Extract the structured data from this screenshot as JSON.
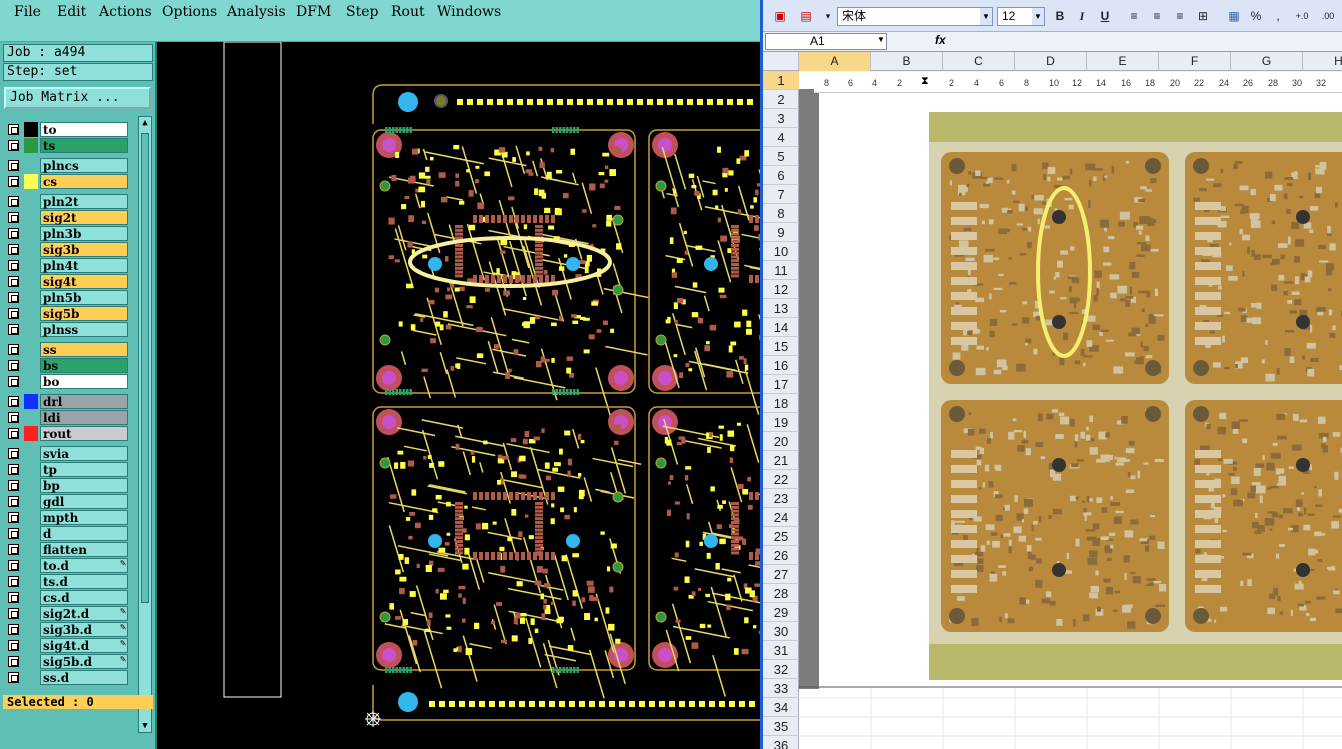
{
  "cam": {
    "menu": [
      "File",
      "Edit",
      "Actions",
      "Options",
      "Analysis",
      "DFM",
      "Step",
      "Rout",
      "Windows"
    ],
    "job_label": "Job : a494",
    "step_label": "Step: set",
    "job_matrix_button": "Job Matrix ...",
    "selected_status": "Selected : 0",
    "layers": [
      {
        "name": "to",
        "color": "#ffffff",
        "swatch": "#000000"
      },
      {
        "name": "ts",
        "color": "#2aa36a",
        "swatch": "#2a9a44"
      },
      {
        "name": "plncs",
        "color": "#8fe0d8",
        "swatch": ""
      },
      {
        "name": "cs",
        "color": "#ffce57",
        "swatch": "#ffff55"
      },
      {
        "name": "pln2t",
        "color": "#8fe0d8",
        "swatch": ""
      },
      {
        "name": "sig2t",
        "color": "#ffce57",
        "swatch": ""
      },
      {
        "name": "pln3b",
        "color": "#8fe0d8",
        "swatch": ""
      },
      {
        "name": "sig3b",
        "color": "#ffce57",
        "swatch": ""
      },
      {
        "name": "pln4t",
        "color": "#8fe0d8",
        "swatch": ""
      },
      {
        "name": "sig4t",
        "color": "#ffce57",
        "swatch": ""
      },
      {
        "name": "pln5b",
        "color": "#8fe0d8",
        "swatch": ""
      },
      {
        "name": "sig5b",
        "color": "#ffce57",
        "swatch": ""
      },
      {
        "name": "plnss",
        "color": "#8fe0d8",
        "swatch": ""
      },
      {
        "name": "ss",
        "color": "#ffce57",
        "swatch": ""
      },
      {
        "name": "bs",
        "color": "#2aa36a",
        "swatch": ""
      },
      {
        "name": "bo",
        "color": "#ffffff",
        "swatch": ""
      },
      {
        "name": "drl",
        "color": "#9aa3a8",
        "swatch": "#1030ff"
      },
      {
        "name": "ldi",
        "color": "#9aa3a8",
        "swatch": ""
      },
      {
        "name": "rout",
        "color": "#c9cdd0",
        "swatch": "#ff2020"
      },
      {
        "name": "svia",
        "color": "#8fe0d8",
        "swatch": ""
      },
      {
        "name": "tp",
        "color": "#8fe0d8",
        "swatch": ""
      },
      {
        "name": "bp",
        "color": "#8fe0d8",
        "swatch": ""
      },
      {
        "name": "gdl",
        "color": "#8fe0d8",
        "swatch": ""
      },
      {
        "name": "mpth",
        "color": "#8fe0d8",
        "swatch": ""
      },
      {
        "name": "d",
        "color": "#8fe0d8",
        "swatch": ""
      },
      {
        "name": "flatten",
        "color": "#8fe0d8",
        "swatch": ""
      },
      {
        "name": "to.d",
        "color": "#8fe0d8",
        "swatch": ""
      },
      {
        "name": "ts.d",
        "color": "#8fe0d8",
        "swatch": ""
      },
      {
        "name": "cs.d",
        "color": "#8fe0d8",
        "swatch": ""
      },
      {
        "name": "sig2t.d",
        "color": "#8fe0d8",
        "swatch": ""
      },
      {
        "name": "sig3b.d",
        "color": "#8fe0d8",
        "swatch": ""
      },
      {
        "name": "sig4t.d",
        "color": "#8fe0d8",
        "swatch": ""
      },
      {
        "name": "sig5b.d",
        "color": "#8fe0d8",
        "swatch": ""
      },
      {
        "name": "ss.d",
        "color": "#8fe0d8",
        "swatch": ""
      }
    ]
  },
  "excel": {
    "font_name": "宋体",
    "font_size": "12",
    "name_box": "A1",
    "fx": "fx",
    "columns": [
      "A",
      "B",
      "C",
      "D",
      "E",
      "F",
      "G",
      "H"
    ],
    "rows": [
      "1",
      "2",
      "3",
      "4",
      "5",
      "6",
      "7",
      "8",
      "9",
      "10",
      "11",
      "12",
      "13",
      "14",
      "15",
      "16",
      "17",
      "18",
      "19",
      "20",
      "21",
      "22",
      "23",
      "24",
      "25",
      "26",
      "27",
      "28",
      "29",
      "30",
      "31",
      "32",
      "33",
      "34",
      "35",
      "36"
    ],
    "ruler_ticks": [
      "8",
      "6",
      "4",
      "2",
      "2",
      "4",
      "6",
      "8",
      "10",
      "12",
      "14",
      "16",
      "18",
      "20",
      "22",
      "24",
      "26",
      "28",
      "30",
      "32"
    ],
    "toolbar_buttons": [
      "B",
      "I",
      "U",
      "%",
      ","
    ]
  }
}
